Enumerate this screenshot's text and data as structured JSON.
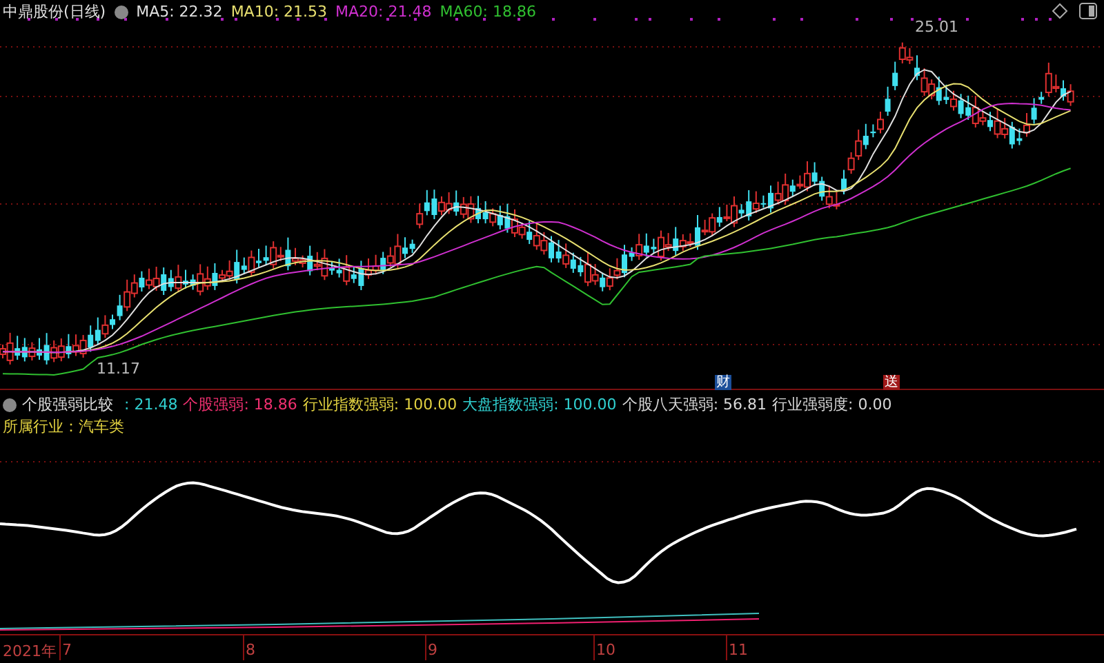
{
  "header": {
    "title": "中鼎股份(日线)",
    "ma_legend": [
      {
        "label": "MA5: 22.32",
        "color": "#e0e0e0"
      },
      {
        "label": "MA10: 21.53",
        "color": "#e8e070"
      },
      {
        "label": "MA20: 21.48",
        "color": "#d030d0"
      },
      {
        "label": "MA60: 18.86",
        "color": "#30c030"
      }
    ]
  },
  "price_chart": {
    "high_marker": "25.01",
    "low_marker": "11.17",
    "event_badges": [
      {
        "text": "财",
        "color": "#1c4f9a"
      },
      {
        "text": "送",
        "color": "#a01818"
      }
    ]
  },
  "indicator": {
    "name": "个股强弱比较",
    "values": [
      {
        "value": ": 21.48",
        "color": "#30d0d0"
      },
      {
        "label": "个股强弱",
        "value": ": 18.86",
        "color": "#f03070"
      },
      {
        "label": "行业指数强弱",
        "value": ": 100.00",
        "color": "#e0d040"
      },
      {
        "label": "大盘指数强弱",
        "value": ": 100.00",
        "color": "#30d0d0"
      },
      {
        "label": "个股八天强弱",
        "value": ": 56.81",
        "color": "#d8d8d8"
      },
      {
        "label": "行业强弱度",
        "value": ": 0.00",
        "color": "#d8d8d8"
      }
    ],
    "industry": "所属行业：汽车类"
  },
  "time_axis": {
    "year": "2021年",
    "months": [
      "7",
      "8",
      "9",
      "10",
      "11"
    ]
  }
}
